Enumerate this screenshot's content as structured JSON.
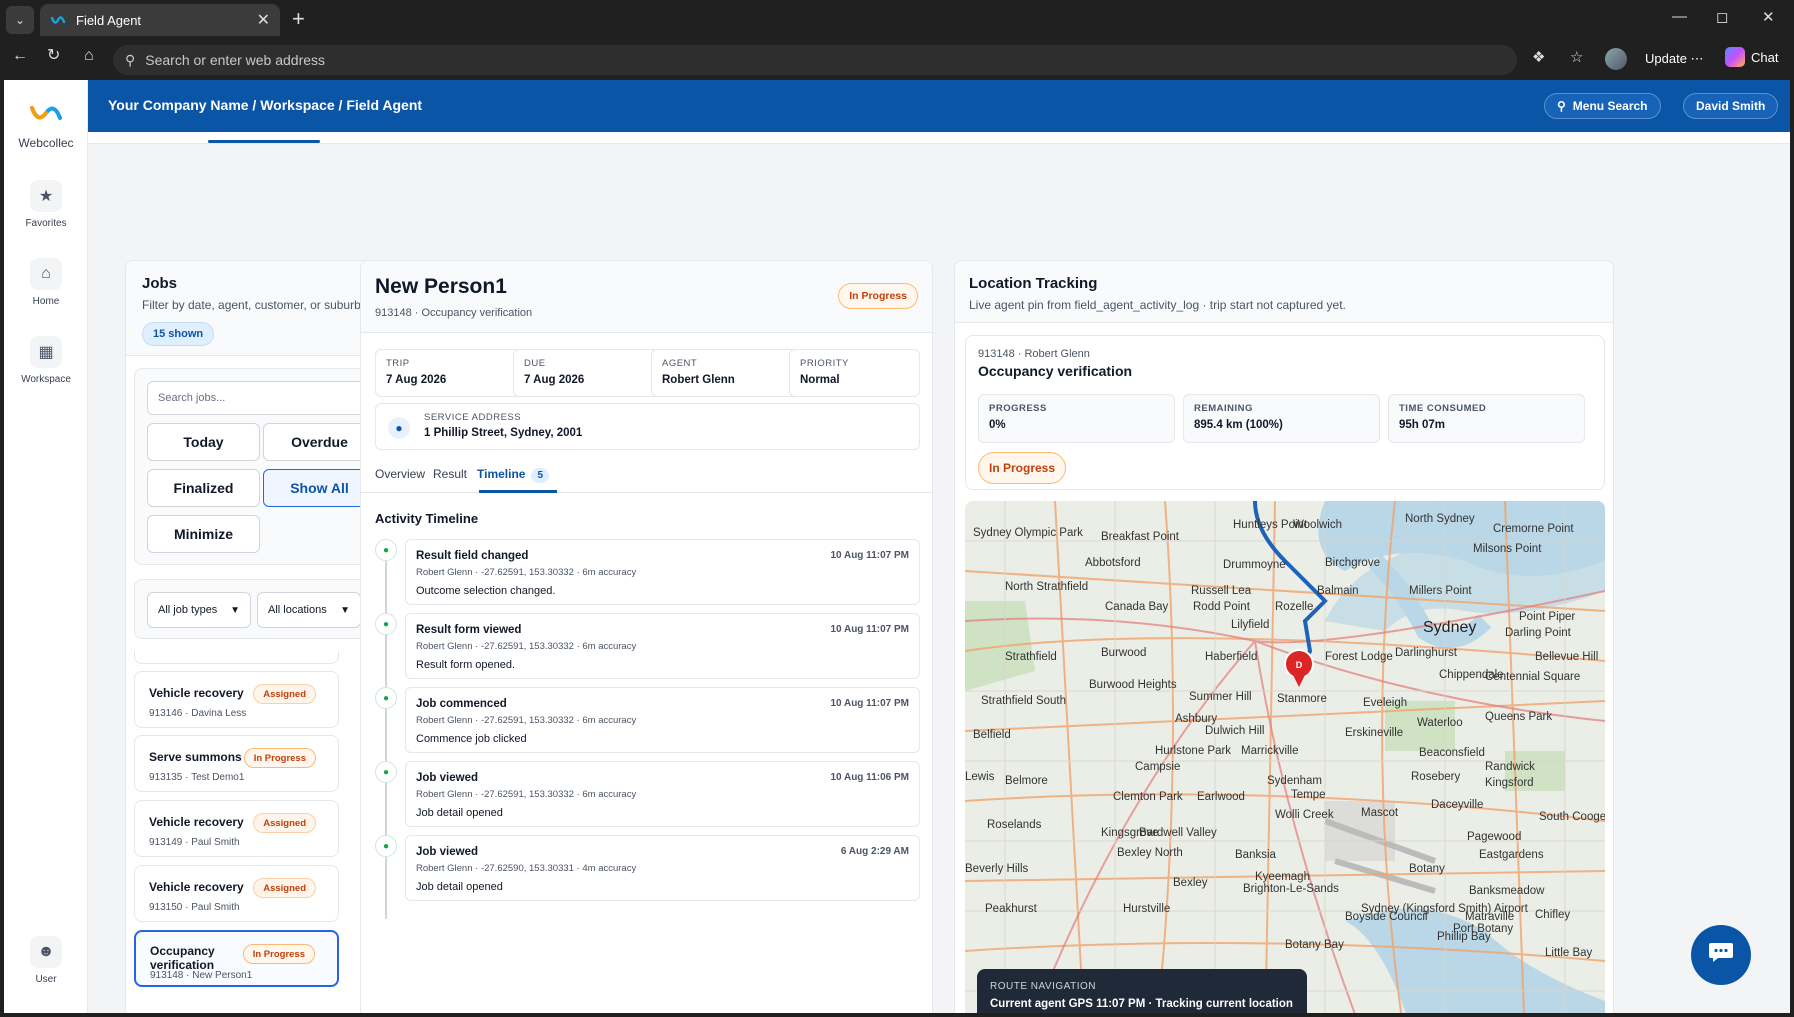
{
  "browser": {
    "tab_title": "Field Agent",
    "url_placeholder": "Search or enter web address",
    "update_label": "Update",
    "chat_label": "Chat"
  },
  "sidebar": {
    "brand": "Webcollec",
    "items": [
      {
        "label": "Favorites",
        "icon": "star-icon"
      },
      {
        "label": "Home",
        "icon": "home-icon"
      },
      {
        "label": "Workspace",
        "icon": "grid-icon"
      }
    ],
    "user_label": "User"
  },
  "header": {
    "breadcrumb": "Your Company Name / Workspace / Field Agent",
    "menu_search": "Menu Search",
    "user_name": "David Smith"
  },
  "jobs": {
    "title": "Jobs",
    "subtitle": "Filter by date, agent, customer, or suburb.",
    "shown_count": "15 shown",
    "search_placeholder": "Search jobs...",
    "filters": [
      "Today",
      "Overdue",
      "Finalized",
      "Show All",
      "Minimize"
    ],
    "active_filter": "Show All",
    "job_type_select": "All job types",
    "location_select": "All locations",
    "list": [
      {
        "title": "Vehicle recovery",
        "meta": "913146 · Davina Less",
        "status": "Assigned"
      },
      {
        "title": "Serve summons",
        "meta": "913135 · Test Demo1",
        "status": "In Progress"
      },
      {
        "title": "Vehicle recovery",
        "meta": "913149 · Paul Smith",
        "status": "Assigned"
      },
      {
        "title": "Vehicle recovery",
        "meta": "913150 · Paul Smith",
        "status": "Assigned"
      },
      {
        "title": "Occupancy verification",
        "meta": "913148 · New Person1",
        "status": "In Progress"
      }
    ]
  },
  "detail": {
    "name": "New Person1",
    "meta": "913148 · Occupancy verification",
    "status": "In Progress",
    "fields": [
      {
        "label": "TRIP",
        "value": "7 Aug 2026"
      },
      {
        "label": "DUE",
        "value": "7 Aug 2026"
      },
      {
        "label": "AGENT",
        "value": "Robert Glenn"
      },
      {
        "label": "PRIORITY",
        "value": "Normal"
      }
    ],
    "address_label": "SERVICE ADDRESS",
    "address": "1 Phillip Street, Sydney, 2001",
    "tabs": [
      "Overview",
      "Result",
      "Timeline"
    ],
    "timeline_count": "5",
    "timeline_title": "Activity Timeline",
    "events": [
      {
        "title": "Result field changed",
        "time": "10 Aug 11:07 PM",
        "meta": "Robert Glenn · -27.62591, 153.30332 · 6m accuracy",
        "desc": "Outcome selection changed."
      },
      {
        "title": "Result form viewed",
        "time": "10 Aug 11:07 PM",
        "meta": "Robert Glenn · -27.62591, 153.30332 · 6m accuracy",
        "desc": "Result form opened."
      },
      {
        "title": "Job commenced",
        "time": "10 Aug 11:07 PM",
        "meta": "Robert Glenn · -27.62591, 153.30332 · 6m accuracy",
        "desc": "Commence job clicked"
      },
      {
        "title": "Job viewed",
        "time": "10 Aug 11:06 PM",
        "meta": "Robert Glenn · -27.62591, 153.30332 · 6m accuracy",
        "desc": "Job detail opened"
      },
      {
        "title": "Job viewed",
        "time": "6 Aug 2:29 AM",
        "meta": "Robert Glenn · -27.62590, 153.30331 · 4m accuracy",
        "desc": "Job detail opened"
      }
    ]
  },
  "location": {
    "title": "Location Tracking",
    "subtitle": "Live agent pin from field_agent_activity_log · trip start not captured yet.",
    "job_meta": "913148 · Robert Glenn",
    "job_title": "Occupancy verification",
    "metrics": [
      {
        "label": "PROGRESS",
        "value": "0%"
      },
      {
        "label": "REMAINING",
        "value": "895.4 km (100%)"
      },
      {
        "label": "TIME CONSUMED",
        "value": "95h 07m"
      }
    ],
    "status": "In Progress",
    "route_label": "ROUTE NAVIGATION",
    "route_text": "Current agent GPS 11:07 PM · Tracking current location",
    "pin_label": "D",
    "map_labels": [
      "North Sydney",
      "Sydney Olympic Park",
      "Breakfast Point",
      "Huntleys Point",
      "Woolwich",
      "Cremorne Point",
      "Milsons Point",
      "Abbotsford",
      "Drummoyne",
      "Birchgrove",
      "North Strathfield",
      "Russell Lea",
      "Balmain",
      "Millers Point",
      "Canada Bay",
      "Rodd Point",
      "Rozelle",
      "Sydney",
      "Point Piper",
      "Lilyfield",
      "Darling Point",
      "Strathfield",
      "Burwood",
      "Haberfield",
      "Forest Lodge",
      "Darlinghurst",
      "Bellevue Hill",
      "Chippendale",
      "Centennial Square",
      "Burwood Heights",
      "Summer Hill",
      "Stanmore",
      "Strathfield South",
      "Ashbury",
      "Eveleigh",
      "Queens Park",
      "Belfield",
      "Dulwich Hill",
      "Erskineville",
      "Waterloo",
      "Hurlstone Park",
      "Marrickville",
      "Beaconsfield",
      "Randwick",
      "Campsie",
      "Lewis",
      "Belmore",
      "Sydenham",
      "Rosebery",
      "Kingsford",
      "Clemton Park",
      "Earlwood",
      "Tempe",
      "Mascot",
      "Daceyville",
      "Roselands",
      "Wolli Creek",
      "South Coogee",
      "Kingsgrove",
      "Bardwell Valley",
      "Pagewood",
      "Bexley North",
      "Banksia",
      "Botany",
      "Eastgardens",
      "Beverly Hills",
      "Kyeemagh",
      "Bexley",
      "Brighton-Le-Sands",
      "Banksmeadow",
      "Peakhurst",
      "Hurstville",
      "Matraville",
      "Sydney (Kingsford Smith) Airport",
      "Port Botany",
      "Chifley",
      "Phillip Bay",
      "Little Bay",
      "Botany Bay",
      "Boyside Council"
    ]
  }
}
